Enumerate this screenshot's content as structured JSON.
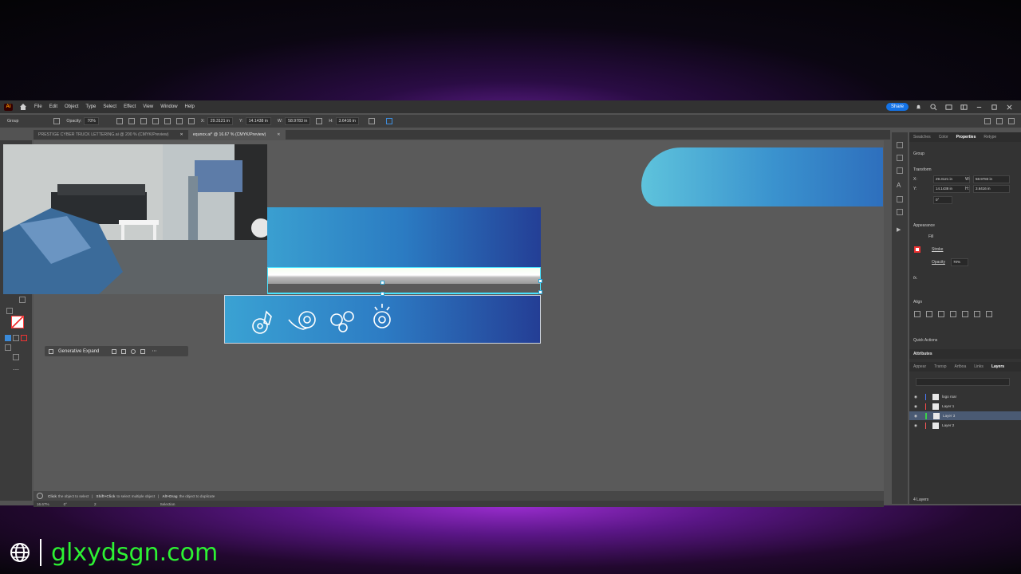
{
  "app": {
    "logo": "Ai",
    "menu": [
      "File",
      "Edit",
      "Object",
      "Type",
      "Select",
      "Effect",
      "View",
      "Window",
      "Help"
    ],
    "share_label": "Share"
  },
  "control_bar": {
    "selection_label": "Group",
    "opacity_label": "Opacity:",
    "opacity_value": "70%",
    "x_label": "X:",
    "x_value": "29.3121 in",
    "y_label": "Y:",
    "y_value": "14.1438 in",
    "w_label": "W:",
    "w_value": "58.9783 in",
    "h_label": "H:",
    "h_value": "3.6416 in"
  },
  "tabs": [
    {
      "label": "PRESTIGE CYBER TRUCK LETTERING.ai @ 200 % (CMYK/Preview)",
      "active": false
    },
    {
      "label": "equnox.ai* @ 16.67 % (CMYK/Preview)",
      "active": true
    }
  ],
  "generative_expand": {
    "label": "Generative Expand"
  },
  "status_bar": {
    "hint_click": "Click",
    "hint_click_text": "the object to select",
    "hint_shift": "Shift+Click",
    "hint_shift_text": "to select multiple object",
    "hint_alt": "Alt+Drag",
    "hint_alt_text": "the object to duplicate",
    "zoom": "16.67%",
    "rotation": "0°",
    "artboard_num": "2",
    "tool_name": "Selection"
  },
  "properties_panel": {
    "tabs": [
      "Swatches",
      "Color",
      "Properties",
      "Retype"
    ],
    "active_tab": "Properties",
    "selection": "Group",
    "transform_title": "Transform",
    "x_label": "X:",
    "x_value": "29.3121 in",
    "y_label": "Y:",
    "y_value": "14.1438 in",
    "w_label": "W:",
    "w_value": "58.9783 in",
    "h_label": "H:",
    "h_value": "3.6416 in",
    "angle": "0°",
    "appearance_title": "Appearance",
    "fill_label": "Fill",
    "stroke_label": "Stroke",
    "opacity_label": "Opacity",
    "opacity_value": "70%",
    "fx_label": "fx.",
    "align_title": "Align",
    "quick_actions_title": "Quick Actions"
  },
  "attributes_panel": {
    "title": "Attributes",
    "tabs": [
      "Appear",
      "Transp",
      "Artboa",
      "Links",
      "Layers"
    ],
    "active_tab": "Layers",
    "layers": [
      {
        "name": "logo roar",
        "color": "#4a7bff",
        "selected": false
      },
      {
        "name": "Layer 1",
        "color": "#ff4a4a",
        "selected": false
      },
      {
        "name": "Layer 3",
        "color": "#3bd14a",
        "selected": true
      },
      {
        "name": "Layer 2",
        "color": "#ff5a5a",
        "selected": false
      }
    ],
    "count_label": "4 Layers"
  },
  "watermark": {
    "url": "glxydsgn.com"
  },
  "colors": {
    "accent": "#1473e6",
    "url_green": "#2df233",
    "selection_cyan": "#49e3ff"
  }
}
